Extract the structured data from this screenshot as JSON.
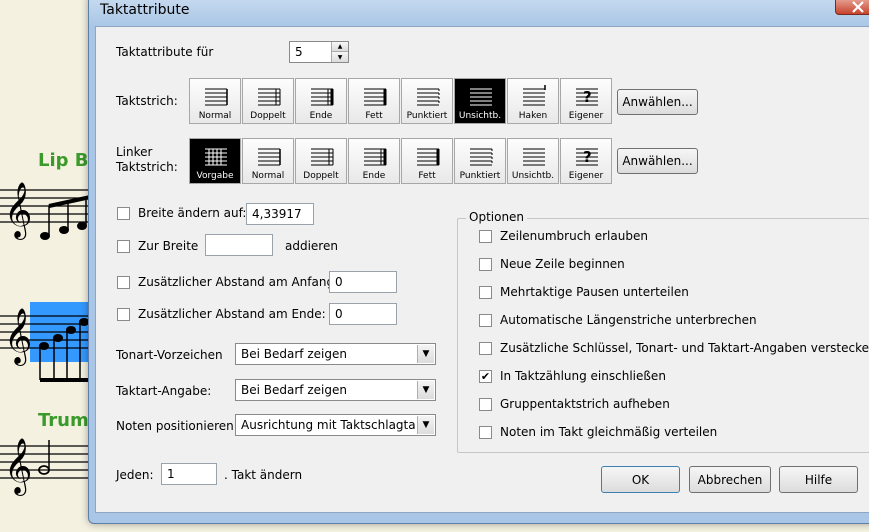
{
  "window": {
    "title": "Taktattribute"
  },
  "score": {
    "staff1_label": "Lip Bu",
    "staff2_label": "Trump"
  },
  "measure": {
    "label": "Taktattribute für",
    "value": "5"
  },
  "barline": {
    "label": "Taktstrich:",
    "options": [
      "Normal",
      "Doppelt",
      "Ende",
      "Fett",
      "Punktiert",
      "Unsichtb.",
      "Haken",
      "Eigener"
    ],
    "selected_index": 5,
    "select_button": "Anwählen..."
  },
  "left_barline": {
    "label_line1": "Linker",
    "label_line2": "Taktstrich:",
    "options": [
      "Vorgabe",
      "Normal",
      "Doppelt",
      "Ende",
      "Fett",
      "Punktiert",
      "Unsichtb.",
      "Eigener"
    ],
    "selected_index": 0,
    "select_button": "Anwählen..."
  },
  "width_change": {
    "label": "Breite ändern auf:",
    "value": "4,33917",
    "checked": false
  },
  "width_add": {
    "label": "Zur Breite",
    "value": "",
    "suffix": "addieren",
    "checked": false
  },
  "space_start": {
    "label": "Zusätzlicher Abstand am Anfang",
    "value": "0",
    "checked": false
  },
  "space_end": {
    "label": "Zusätzlicher Abstand am Ende:",
    "value": "0",
    "checked": false
  },
  "key_signature": {
    "label": "Tonart-Vorzeichen",
    "value": "Bei Bedarf zeigen"
  },
  "time_signature": {
    "label": "Taktart-Angabe:",
    "value": "Bei Bedarf zeigen"
  },
  "note_position": {
    "label": "Noten positionieren:",
    "value": "Ausrichtung mit Taktschlagtabelle"
  },
  "every": {
    "label": "Jeden:",
    "value": "1",
    "suffix": ". Takt ändern"
  },
  "options": {
    "title": "Optionen",
    "items": [
      {
        "label": "Zeilenumbruch erlauben",
        "checked": false
      },
      {
        "label": "Neue Zeile beginnen",
        "checked": false
      },
      {
        "label": "Mehrtaktige Pausen unterteilen",
        "checked": false
      },
      {
        "label": "Automatische Längenstriche unterbrechen",
        "checked": false
      },
      {
        "label": "Zusätzliche Schlüssel, Tonart- und Taktart-Angaben verstecke",
        "checked": false
      },
      {
        "label": "In Taktzählung einschließen",
        "checked": true
      },
      {
        "label": "Gruppentaktstrich aufheben",
        "checked": false
      },
      {
        "label": "Noten im Takt gleichmäßig verteilen",
        "checked": false
      }
    ]
  },
  "buttons": {
    "ok": "OK",
    "cancel": "Abbrechen",
    "help": "Hilfe"
  },
  "colors": {
    "selection": "#3399ff",
    "staff_label": "#3a9a2a",
    "dialog_frame": "#a9c6e6"
  }
}
